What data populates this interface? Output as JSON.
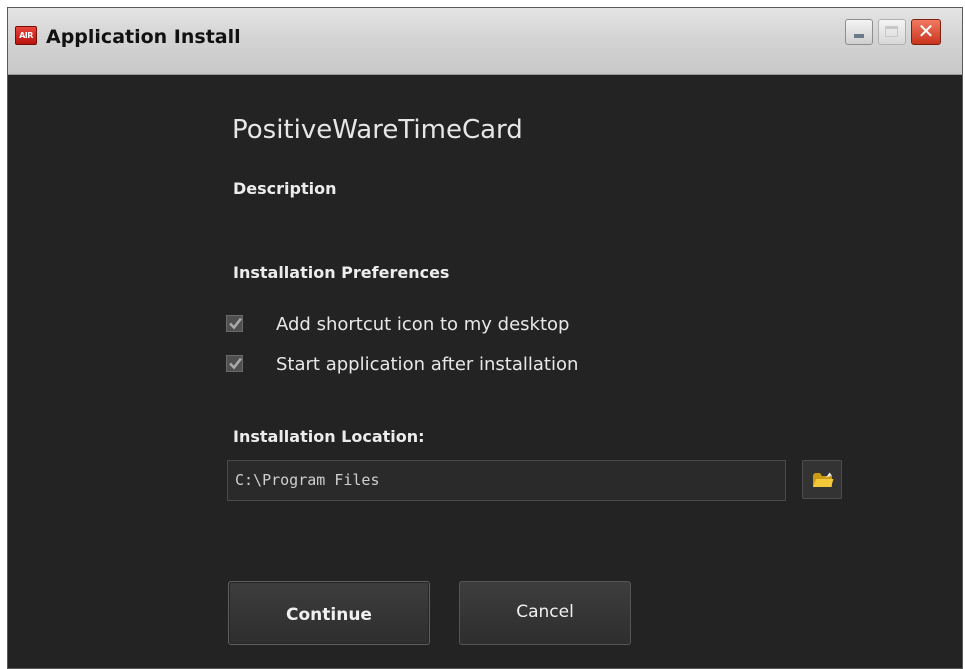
{
  "window": {
    "title": "Application Install",
    "app_icon_text": "AIR",
    "close_glyph": "✕"
  },
  "content": {
    "app_name": "PositiveWareTimeCard",
    "description_label": "Description",
    "preferences_label": "Installation Preferences",
    "options": [
      {
        "label": "Add shortcut icon to my desktop",
        "checked": true
      },
      {
        "label": "Start application after installation",
        "checked": true
      }
    ],
    "location_label": "Installation Location:",
    "location_value": "C:\\Program Files"
  },
  "buttons": {
    "continue_label": "Continue",
    "cancel_label": "Cancel"
  },
  "colors": {
    "background": "#232323",
    "text": "#e8e8e8",
    "close_button": "#c9341d",
    "folder_icon": "#e8b923"
  },
  "icons": {
    "app": "air-logo-icon",
    "minimize": "minimize-icon",
    "maximize": "maximize-icon",
    "close": "close-icon",
    "browse": "folder-icon",
    "check": "checkmark-icon"
  }
}
